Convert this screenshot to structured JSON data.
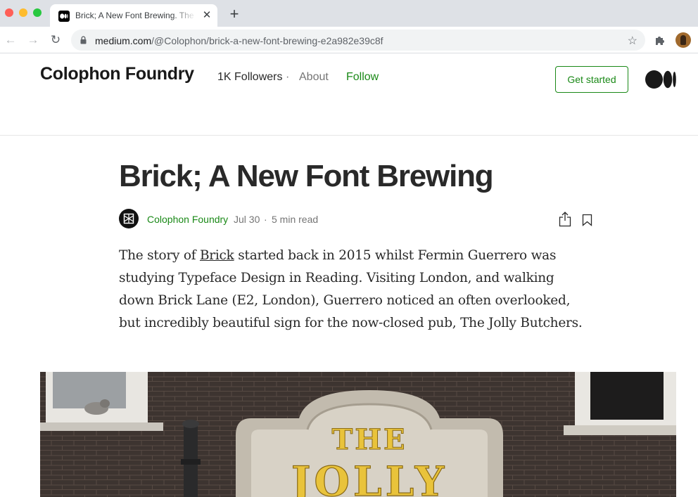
{
  "browser": {
    "tab_title": "Brick; A New Font Brewing. The",
    "tab_close": "✕",
    "new_tab": "+",
    "url_host": "medium.com",
    "url_path": "/@Colophon/brick-a-new-font-brewing-e2a982e39c8f",
    "back_glyph": "←",
    "forward_glyph": "→",
    "reload_glyph": "↻",
    "star_glyph": "☆"
  },
  "header": {
    "publication": "Colophon Foundry",
    "followers": "1K Followers",
    "separator": "·",
    "about": "About",
    "follow": "Follow",
    "get_started": "Get started"
  },
  "article": {
    "title": "Brick; A New Font Brewing",
    "author": "Colophon Foundry",
    "date": "Jul 30",
    "meta_separator": "·",
    "read_time": "5 min read",
    "body_pre": "The story of ",
    "body_link": "Brick",
    "body_post": " started back in 2015 whilst Fermin Guerrero was studying Typeface Design in Reading. Visiting London, and walking down Brick Lane (E2, London), Guerrero noticed an often overlooked, but incredibly beautiful sign for the now-closed pub, The Jolly Butchers."
  },
  "hero_image": {
    "sign_line1": "THE",
    "sign_line2": "JOLLY"
  },
  "colors": {
    "accent_green": "#1a8917",
    "text": "#292929",
    "muted": "#757575",
    "sign_gold": "#e9c33b"
  },
  "icons": [
    "medium-favicon-icon",
    "lock-icon",
    "star-icon",
    "extensions-icon",
    "profile-avatar",
    "medium-logo-icon",
    "author-avatar-icon",
    "share-icon",
    "bookmark-icon"
  ]
}
